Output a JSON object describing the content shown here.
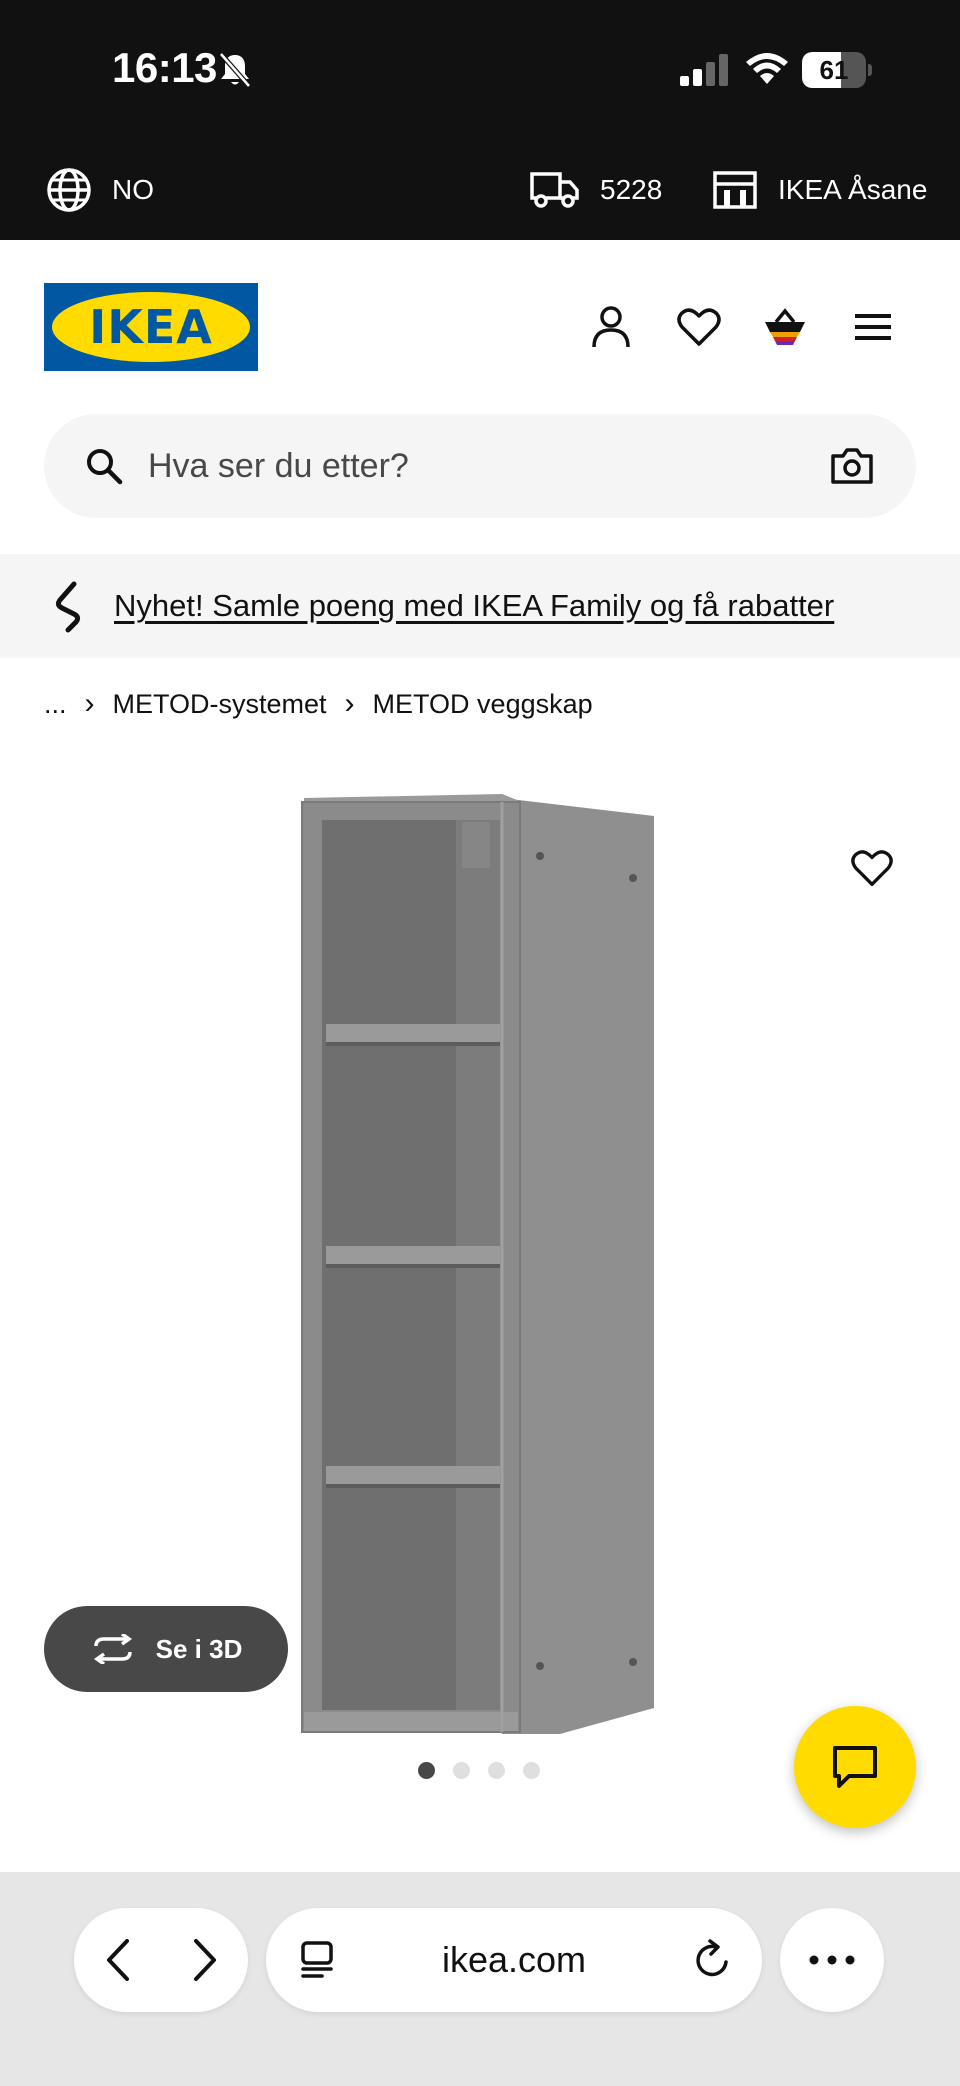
{
  "status_bar": {
    "time": "16:13",
    "battery_level": "61",
    "icons": [
      "bell-slash-icon",
      "signal-icon",
      "wifi-icon",
      "battery-icon"
    ]
  },
  "utility_bar": {
    "language": "NO",
    "postal_code": "5228",
    "store": "IKEA Åsane",
    "icons": [
      "globe-icon",
      "delivery-truck-icon",
      "store-icon"
    ]
  },
  "header": {
    "logo_text": "IKEA",
    "icons": [
      "account-icon",
      "heart-icon",
      "basket-icon",
      "menu-icon"
    ]
  },
  "search": {
    "placeholder": "Hva ser du etter?"
  },
  "promo": {
    "text": "Nyhet! Samle poeng med IKEA Family og få rabatter"
  },
  "breadcrumb": {
    "ellipsis": "...",
    "items": [
      "METOD-systemet",
      "METOD veggskap"
    ]
  },
  "product": {
    "see_3d_label": "Se i 3D",
    "image_count": 4,
    "active_image": 1
  },
  "browser": {
    "url": "ikea.com"
  },
  "colors": {
    "ikea_blue": "#0058a3",
    "ikea_yellow": "#ffdb00",
    "dark": "#111111",
    "grey_button": "#484848",
    "light_grey": "#f5f5f5"
  }
}
